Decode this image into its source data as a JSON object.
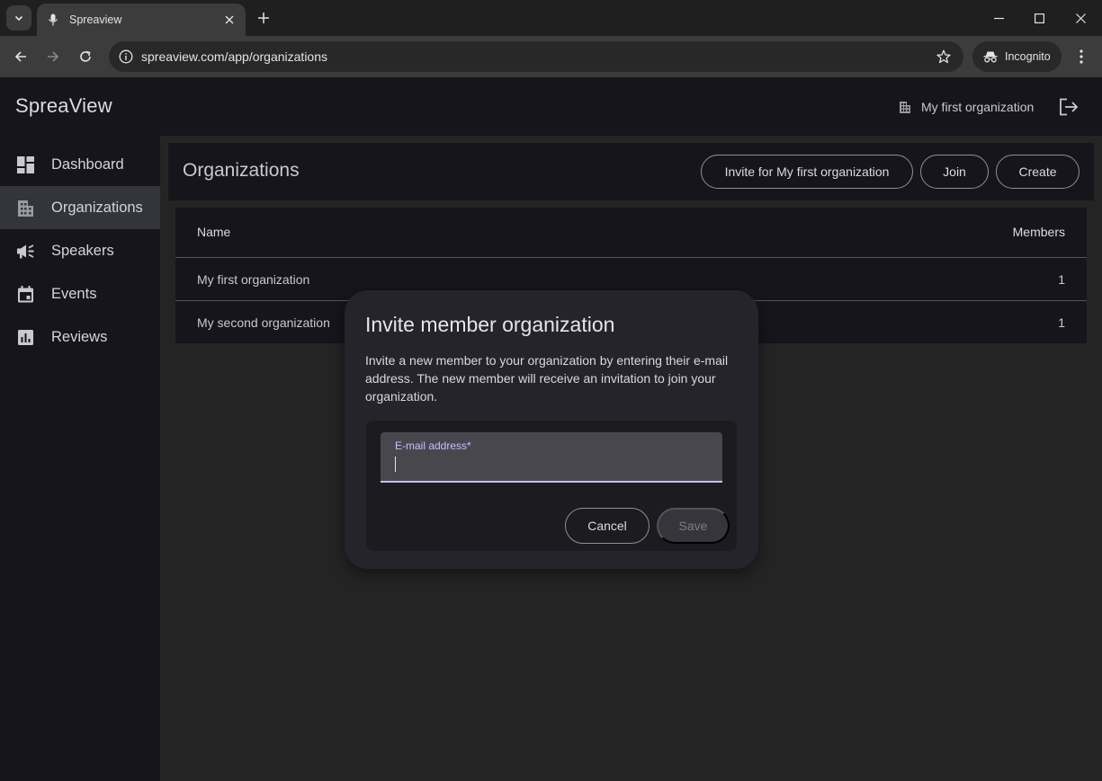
{
  "browser": {
    "tab_title": "Spreaview",
    "url": "spreaview.com/app/organizations",
    "incognito_label": "Incognito"
  },
  "app": {
    "brand": "SpreaView",
    "current_org": "My first organization"
  },
  "sidebar": {
    "items": [
      {
        "label": "Dashboard",
        "icon": "dashboard-icon"
      },
      {
        "label": "Organizations",
        "icon": "apartment-icon",
        "active": true
      },
      {
        "label": "Speakers",
        "icon": "campaign-icon"
      },
      {
        "label": "Events",
        "icon": "event-icon"
      },
      {
        "label": "Reviews",
        "icon": "analytics-icon"
      }
    ]
  },
  "page": {
    "title": "Organizations",
    "invite_label": "Invite for My first organization",
    "join_label": "Join",
    "create_label": "Create"
  },
  "table": {
    "columns": [
      "Name",
      "Members"
    ],
    "rows": [
      {
        "name": "My first organization",
        "members": "1"
      },
      {
        "name": "My second organization",
        "members": "1"
      }
    ]
  },
  "dialog": {
    "title": "Invite member organization",
    "text": "Invite a new member to your organization by entering their e-mail address. The new member will receive an invitation to join your organization.",
    "field_label": "E-mail address*",
    "field_value": "",
    "cancel_label": "Cancel",
    "save_label": "Save"
  },
  "colors": {
    "accent": "#c5c0ff",
    "sidebar_bg": "#16151b",
    "active_item_bg": "#34343c"
  }
}
